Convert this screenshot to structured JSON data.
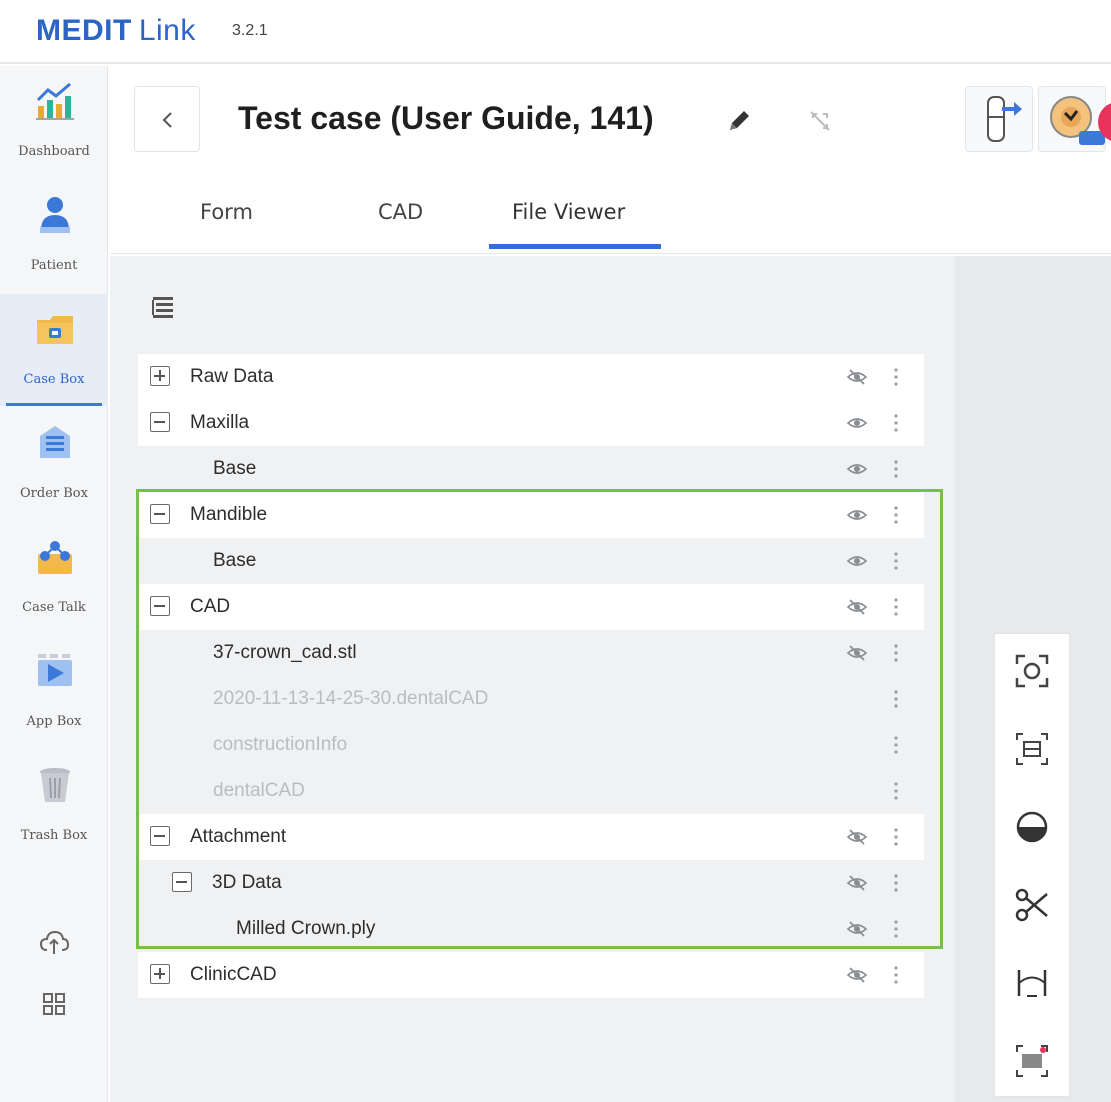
{
  "app": {
    "brand": "MEDIT",
    "brand_suffix": "Link",
    "version": "3.2.1"
  },
  "nav": [
    {
      "label": "Dashboard",
      "icon": "chart-icon"
    },
    {
      "label": "Patient",
      "icon": "patient-icon"
    },
    {
      "label": "Case Box",
      "icon": "case-box-icon",
      "active": true
    },
    {
      "label": "Order Box",
      "icon": "order-box-icon"
    },
    {
      "label": "Case Talk",
      "icon": "case-talk-icon"
    },
    {
      "label": "App Box",
      "icon": "app-box-icon"
    },
    {
      "label": "Trash Box",
      "icon": "trash-icon"
    }
  ],
  "header": {
    "title": "Test case (User Guide, 141)"
  },
  "tabs": [
    {
      "label": "Form"
    },
    {
      "label": "CAD"
    },
    {
      "label": "File Viewer",
      "active": true
    }
  ],
  "tree": [
    {
      "label": "Raw Data",
      "toggle": "plus",
      "visible": false,
      "dim": false
    },
    {
      "label": "Maxilla",
      "toggle": "minus",
      "visible": true,
      "dim": false
    },
    {
      "label": "Base",
      "toggle": null,
      "visible": true,
      "dim": false
    },
    {
      "label": "Mandible",
      "toggle": "minus",
      "visible": true,
      "dim": false
    },
    {
      "label": "Base",
      "toggle": null,
      "visible": true,
      "dim": false
    },
    {
      "label": "CAD",
      "toggle": "minus",
      "visible": false,
      "dim": false
    },
    {
      "label": "37-crown_cad.stl",
      "toggle": null,
      "visible": false,
      "dim": false
    },
    {
      "label": "2020-11-13-14-25-30.dentalCAD",
      "toggle": null,
      "visible": null,
      "dim": true
    },
    {
      "label": "constructionInfo",
      "toggle": null,
      "visible": null,
      "dim": true
    },
    {
      "label": "dentalCAD",
      "toggle": null,
      "visible": null,
      "dim": true
    },
    {
      "label": "Attachment",
      "toggle": "minus",
      "visible": false,
      "dim": false
    },
    {
      "label": "3D Data",
      "toggle": "minus",
      "visible": false,
      "dim": false
    },
    {
      "label": "Milled Crown.ply",
      "toggle": null,
      "visible": false,
      "dim": false
    },
    {
      "label": "ClinicCAD",
      "toggle": "plus",
      "visible": false,
      "dim": false
    }
  ],
  "colors": {
    "brand": "#2b66c6",
    "tab_underline": "#2f6fd6",
    "highlight": "#77c04b"
  }
}
